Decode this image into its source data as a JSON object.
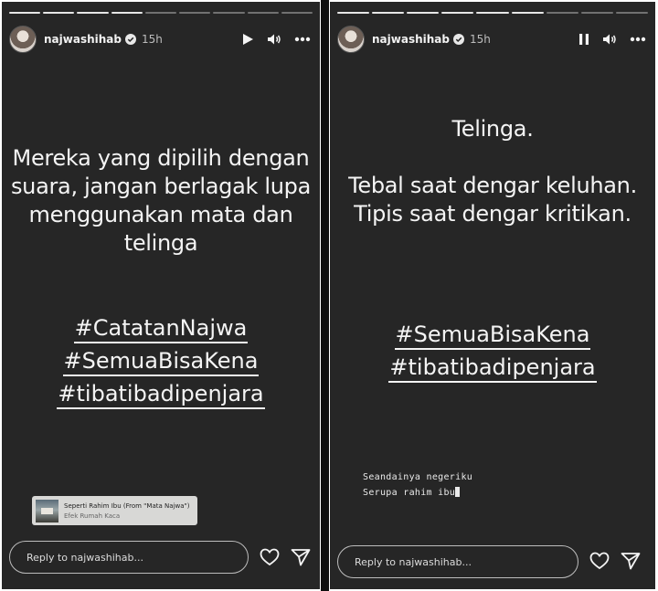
{
  "stories": [
    {
      "username": "najwashihab",
      "time": "15h",
      "progress_done": 4,
      "progress_total": 9,
      "playback_state": "paused",
      "text_lines": [
        "Mereka yang dipilih dengan",
        "suara,  jangan berlagak lupa",
        "menggunakan mata dan",
        "telinga"
      ],
      "hashtags": [
        "#CatatanNajwa",
        "#SemuaBisaKena",
        "#tibatibadipenjara"
      ],
      "music": {
        "title": "Seperti Rahim Ibu (From \"Mata Najwa\")",
        "artist": "Efek Rumah Kaca"
      },
      "reply_placeholder": "Reply to najwashihab..."
    },
    {
      "username": "najwashihab",
      "time": "15h",
      "progress_done": 6,
      "progress_total": 9,
      "playback_state": "playing",
      "text_lines": [
        "Telinga.",
        "",
        "Tebal saat dengar keluhan.",
        "Tipis saat dengar kritikan."
      ],
      "hashtags": [
        "#SemuaBisaKena",
        "#tibatibadipenjara"
      ],
      "lyrics": [
        "Seandainya negeriku",
        "Serupa rahim ibu"
      ],
      "reply_placeholder": "Reply to najwashihab..."
    }
  ],
  "icons": [
    "verified-badge-icon",
    "play-icon",
    "pause-icon",
    "volume-icon",
    "more-icon",
    "heart-icon",
    "send-icon",
    "music-cover-art"
  ],
  "colors": {
    "story_background": "#262626",
    "text": "#f4f4f4",
    "sticker": "#d8d8d6"
  }
}
